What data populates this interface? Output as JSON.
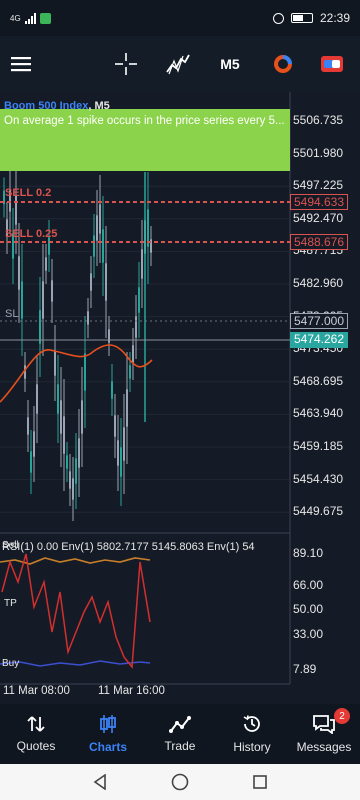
{
  "status_bar": {
    "network": "4G",
    "time": "22:39"
  },
  "toolbar": {
    "timeframe": "M5"
  },
  "chart": {
    "symbol": "Boom 500 Index",
    "timeframe": "M5",
    "banner_text": "On average 1 spike occurs in the price series every 5...",
    "price_scale": [
      "5506.735",
      "5501.980",
      "5497.225",
      "5492.470",
      "5487.715",
      "5482.960",
      "5478.205",
      "5473.450",
      "5468.695",
      "5463.940",
      "5459.185",
      "5454.430",
      "5449.675"
    ],
    "sell_line_1": {
      "label": "SELL 0.2",
      "price": "5494.633"
    },
    "sell_line_2": {
      "label": "SELL 0.25",
      "price": "5488.676"
    },
    "sl_label": "SL",
    "sl_price": "5477.000",
    "current_price": "5474.262",
    "indicator_label": "RSI(1) 0.00 Env(1) 5802.7177 5145.8063 Env(1) 54",
    "indicator_scale": [
      "89.10",
      "66.00",
      "50.00",
      "33.00",
      "7.89"
    ],
    "sub_labels": {
      "sell": "Sell",
      "tp": "TP",
      "buy": "Buy"
    },
    "time_labels": [
      "11 Mar 08:00",
      "11 Mar 16:00"
    ],
    "colors": {
      "banner": "#8bd34a",
      "sell_line": "#d9534f",
      "current_price": "#2aa6a0",
      "envelope": "#e8501c"
    }
  },
  "nav": {
    "items": [
      {
        "label": "Quotes",
        "icon": "quotes-icon"
      },
      {
        "label": "Charts",
        "icon": "charts-icon"
      },
      {
        "label": "Trade",
        "icon": "trade-icon"
      },
      {
        "label": "History",
        "icon": "history-icon"
      },
      {
        "label": "Messages",
        "icon": "messages-icon"
      }
    ],
    "active": "Charts",
    "messages_badge": "2"
  }
}
